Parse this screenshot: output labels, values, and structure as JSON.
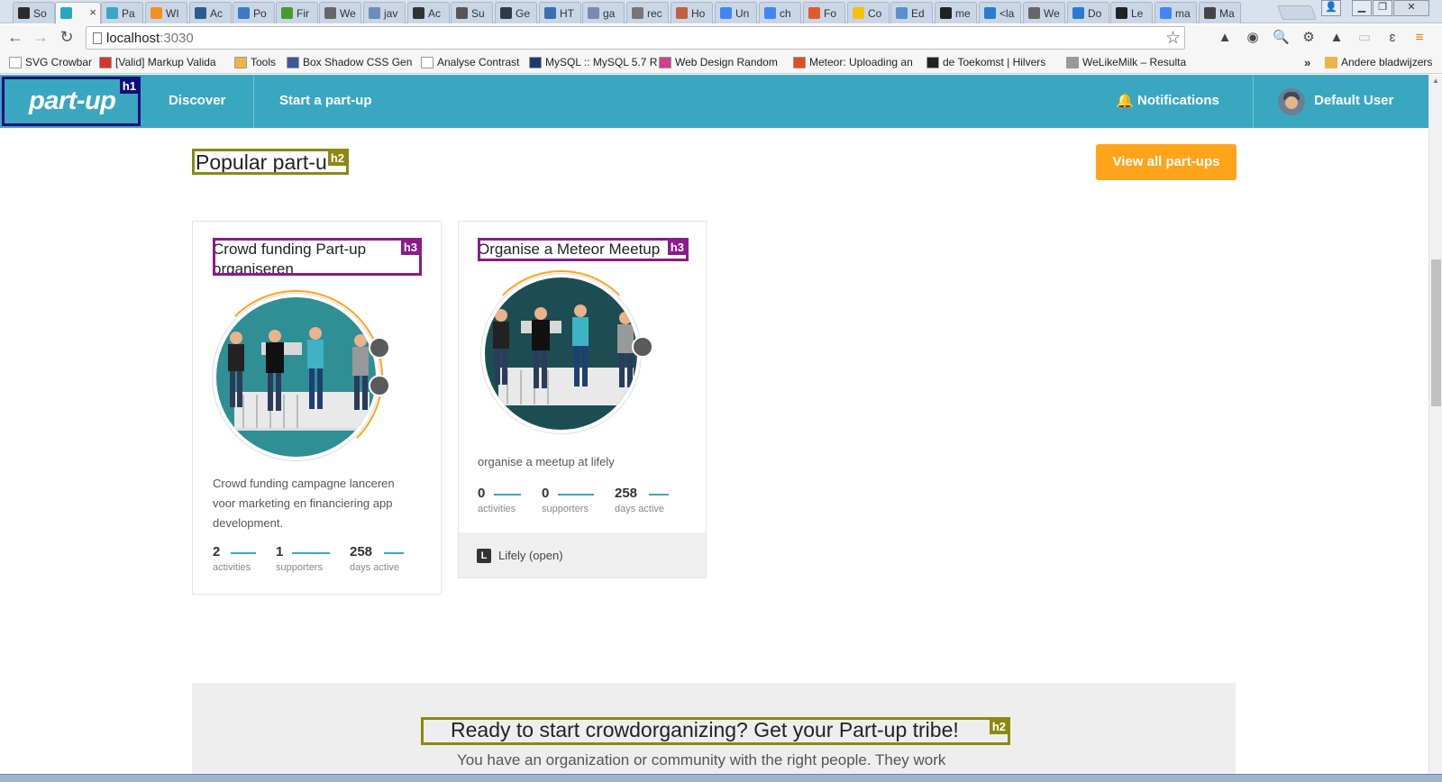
{
  "browser": {
    "tabs": [
      {
        "label": "So",
        "color": "#2b2b2b"
      },
      {
        "label": "",
        "color": "#2aa7c0"
      },
      {
        "label": "Pa",
        "color": "#3aa7c1"
      },
      {
        "label": "WI",
        "color": "#f29020"
      },
      {
        "label": "Ac",
        "color": "#2b5d8b"
      },
      {
        "label": "Po",
        "color": "#3b7bc8"
      },
      {
        "label": "Fir",
        "color": "#4c9a2a"
      },
      {
        "label": "We",
        "color": "#666666"
      },
      {
        "label": "jav",
        "color": "#6a8fb8"
      },
      {
        "label": "Ac",
        "color": "#333333"
      },
      {
        "label": "Su",
        "color": "#555555"
      },
      {
        "label": "Ge",
        "color": "#2a3b4c"
      },
      {
        "label": "HT",
        "color": "#3b6fb0"
      },
      {
        "label": "ga",
        "color": "#7a8bb0"
      },
      {
        "label": "rec",
        "color": "#777777"
      },
      {
        "label": "Ho",
        "color": "#c06040"
      },
      {
        "label": "Un",
        "color": "#4285f4"
      },
      {
        "label": "ch",
        "color": "#4285f4"
      },
      {
        "label": "Fo",
        "color": "#e05a2a"
      },
      {
        "label": "Co",
        "color": "#f4c20d"
      },
      {
        "label": "Ed",
        "color": "#5a8fd0"
      },
      {
        "label": "me",
        "color": "#222222"
      },
      {
        "label": "<la",
        "color": "#2b7bd0"
      },
      {
        "label": "We",
        "color": "#666666"
      },
      {
        "label": "Do",
        "color": "#2b7bd0"
      },
      {
        "label": "Le",
        "color": "#222222"
      },
      {
        "label": "ma",
        "color": "#4285f4"
      },
      {
        "label": "Ma",
        "color": "#444444"
      }
    ],
    "active_tab_close": "×",
    "url_host": "localhost",
    "url_port": ":3030",
    "bookmarks": [
      {
        "label": "SVG Crowbar",
        "color": "#ffffff"
      },
      {
        "label": "[Valid] Markup Valida",
        "color": "#d9342b"
      },
      {
        "label": "Tools",
        "color": "#e8b64a"
      },
      {
        "label": "Box Shadow CSS Gen",
        "color": "#3b5998"
      },
      {
        "label": "Analyse Contrast",
        "color": "#ffffff"
      },
      {
        "label": "MySQL :: MySQL 5.7 R",
        "color": "#1b3a6b"
      },
      {
        "label": "Web Design Random",
        "color": "#d23f8f"
      },
      {
        "label": "Meteor: Uploading an",
        "color": "#de4f1f"
      },
      {
        "label": "de Toekomst | Hilvers",
        "color": "#222222"
      },
      {
        "label": "WeLikeMilk – Resulta",
        "color": "#999999"
      }
    ],
    "bookmarks_more": "»",
    "other_bookmarks": "Andere bladwijzers"
  },
  "header": {
    "logo": "part-up",
    "logo_badge": "h1",
    "nav": [
      "Discover",
      "Start a part-up"
    ],
    "notifications": "Notifications",
    "user": "Default User"
  },
  "popular": {
    "title": "Popular part-u",
    "badge": "h2",
    "view_all": "View all part-ups"
  },
  "cards": [
    {
      "title": "Crowd funding Part-up organiseren",
      "badge": "h3",
      "description": "Crowd funding campagne lanceren voor marketing en financiering app development.",
      "stats": [
        {
          "value": "2",
          "label": "activities"
        },
        {
          "value": "1",
          "label": "supporters"
        },
        {
          "value": "258",
          "label": "days active"
        }
      ]
    },
    {
      "title": "Organise a Meteor Meetup",
      "badge": "h3",
      "description": "organise a meetup at lifely",
      "stats": [
        {
          "value": "0",
          "label": "activities"
        },
        {
          "value": "0",
          "label": "supporters"
        },
        {
          "value": "258",
          "label": "days active"
        }
      ],
      "org_icon": "L",
      "org_name": "Lifely (open)"
    }
  ],
  "cta": {
    "title": "Ready to start crowdorganizing? Get your Part-up tribe!",
    "badge": "h2",
    "subtitle": "You have an organization or community with the right people. They work"
  },
  "colors": {
    "brand": "#3aa7c1",
    "accent": "#ffa41b",
    "h1_outline": "#10107a",
    "h2_outline": "#8a8a10",
    "h3_outline": "#8b1a8b"
  }
}
